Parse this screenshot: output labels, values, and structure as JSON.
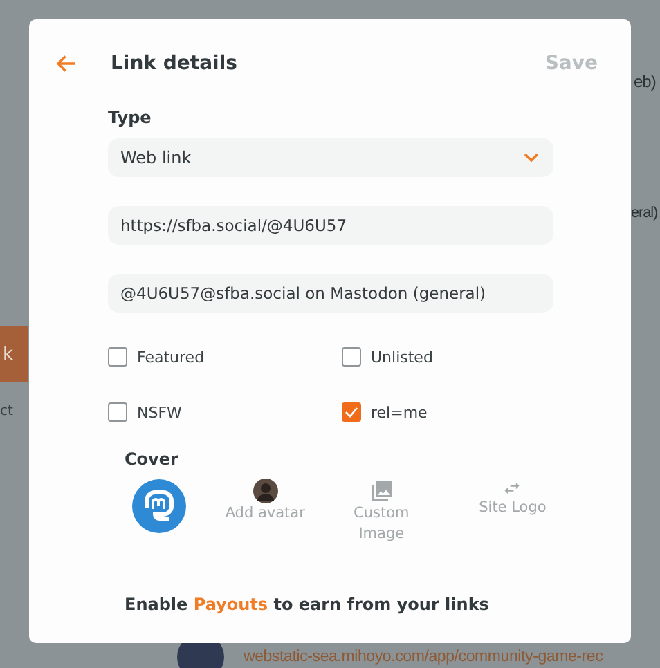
{
  "background": {
    "side_button": "k",
    "side_text": "ct",
    "fragments": [
      "eb)",
      "eral)"
    ],
    "bottom_link": "webstatic-sea.mihoyo.com/app/community-game-rec"
  },
  "dialog": {
    "title": "Link details",
    "save": "Save",
    "type": {
      "label": "Type",
      "value": "Web link"
    },
    "fields": [
      {
        "value": "https://sfba.social/@4U6U57"
      },
      {
        "value": "@4U6U57@sfba.social on Mastodon (general)"
      }
    ],
    "options": [
      {
        "label": "Featured",
        "checked": false
      },
      {
        "label": "Unlisted",
        "checked": false
      },
      {
        "label": "NSFW",
        "checked": false
      },
      {
        "label": "rel=me",
        "checked": true
      }
    ],
    "cover": {
      "label": "Cover",
      "choices": [
        {
          "kind": "logo"
        },
        {
          "kind": "avatar",
          "label": "Add avatar"
        },
        {
          "kind": "image",
          "label": "Custom Image"
        },
        {
          "kind": "site",
          "label": "Site Logo"
        }
      ]
    },
    "footer": {
      "before": "Enable ",
      "link": "Payouts",
      "after": " to earn from your links"
    }
  }
}
